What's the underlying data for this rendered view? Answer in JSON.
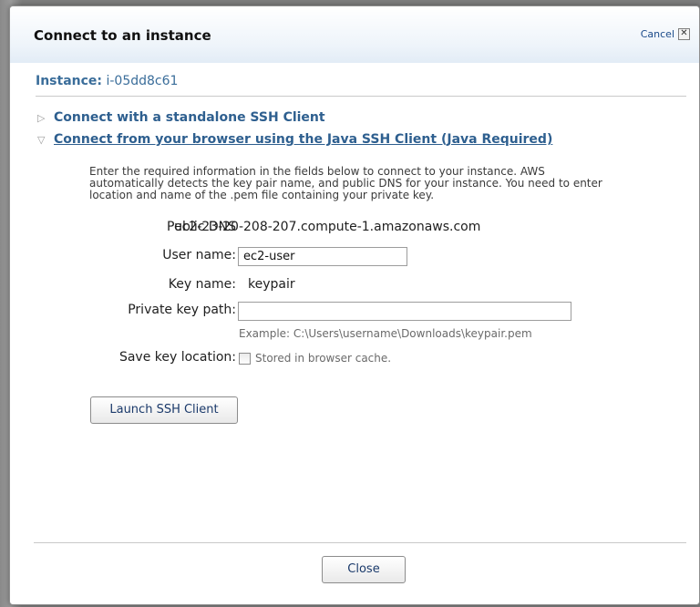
{
  "dialog": {
    "title": "Connect to an instance",
    "cancel_label": "Cancel",
    "cancel_icon": "close-icon"
  },
  "instance": {
    "label": "Instance:",
    "id": "i-05dd8c61"
  },
  "sections": [
    {
      "label": "Connect with a standalone SSH Client",
      "expanded": false,
      "icon": "triangle-right-icon"
    },
    {
      "label": "Connect from your browser using the Java SSH Client (Java Required)",
      "expanded": true,
      "icon": "triangle-down-icon"
    }
  ],
  "description": "Enter the required information in the fields below to connect to your instance. AWS automatically detects the key pair name, and public DNS for your instance. You need to enter location and name of the .pem file containing your private key.",
  "form": {
    "public_dns_label": "Public DNS",
    "public_dns_value": "ec2-23-20-208-207.compute-1.amazonaws.com",
    "user_name_label": "User name:",
    "user_name_value": "ec2-user",
    "key_name_label": "Key name:",
    "key_name_value": "keypair",
    "private_key_label": "Private key path:",
    "private_key_value": "",
    "private_key_example": "Example: C:\\Users\\username\\Downloads\\keypair.pem",
    "save_key_label": "Save key location:",
    "save_key_checkbox_label": "Stored in browser cache.",
    "save_key_checked": false
  },
  "buttons": {
    "launch_label": "Launch SSH Client",
    "close_label": "Close"
  }
}
